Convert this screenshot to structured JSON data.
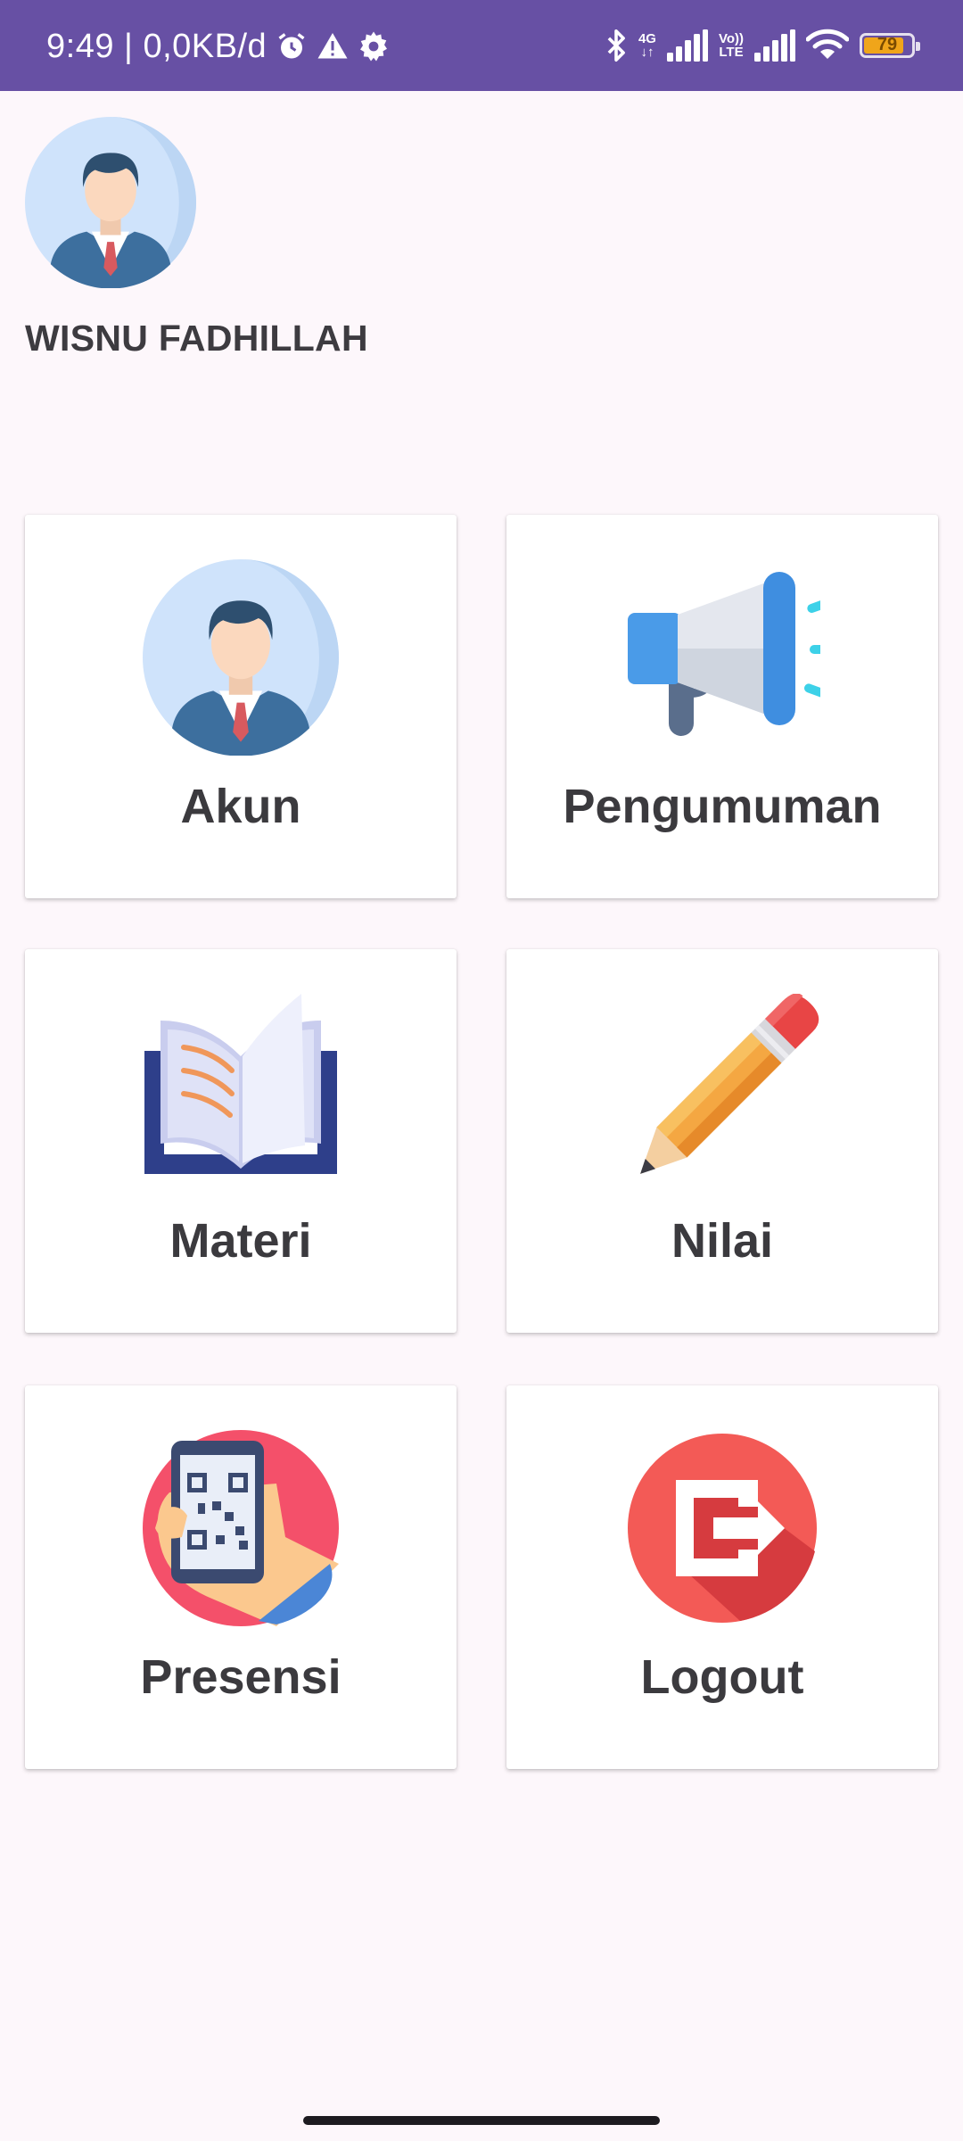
{
  "status_bar": {
    "time_speed": "9:49 | 0,0KB/d",
    "network_4g": "4G",
    "network_volte_top": "Vo))",
    "network_volte_bottom": "LTE",
    "battery": "79",
    "background_color": "#6750a4",
    "icons": [
      "alarm-icon",
      "warning-icon",
      "settings-icon",
      "bluetooth-icon",
      "signal-icon",
      "volte-icon",
      "signal-icon",
      "wifi-icon",
      "battery-icon"
    ]
  },
  "profile": {
    "name": "WISNU FADHILLAH",
    "avatar_icon": "businessman-avatar-icon"
  },
  "menu": {
    "items": [
      {
        "label": "Akun",
        "icon": "businessman-avatar-icon"
      },
      {
        "label": "Pengumuman",
        "icon": "megaphone-icon"
      },
      {
        "label": "Materi",
        "icon": "open-book-icon"
      },
      {
        "label": "Nilai",
        "icon": "pencil-icon"
      },
      {
        "label": "Presensi",
        "icon": "qr-phone-icon"
      },
      {
        "label": "Logout",
        "icon": "logout-icon"
      }
    ]
  }
}
